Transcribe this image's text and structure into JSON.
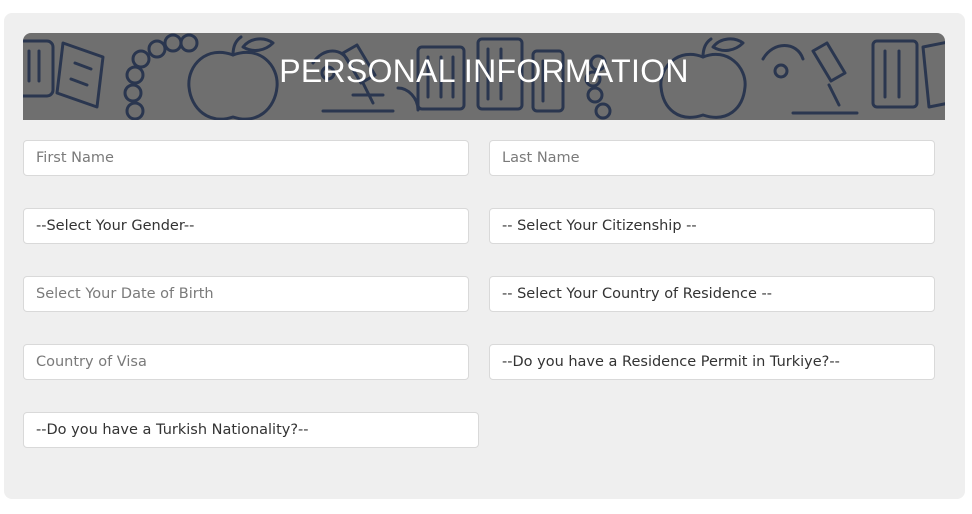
{
  "banner": {
    "title": "PERSONAL INFORMATION"
  },
  "form": {
    "first_name_placeholder": "First Name",
    "last_name_placeholder": "Last Name",
    "gender_select": "--Select Your Gender--",
    "citizenship_select": "-- Select Your Citizenship --",
    "dob_placeholder": "Select Your Date of Birth",
    "residence_country_select": "-- Select Your Country of Residence --",
    "visa_country_placeholder": "Country of Visa",
    "residence_permit_select": "--Do you have a Residence Permit in Turkiye?--",
    "turkish_nationality_select": "--Do you have a Turkish Nationality?--"
  },
  "colors": {
    "banner_bg": "#6f6f6f",
    "pattern_stroke": "#1f2d4a",
    "card_bg": "#efefef"
  }
}
